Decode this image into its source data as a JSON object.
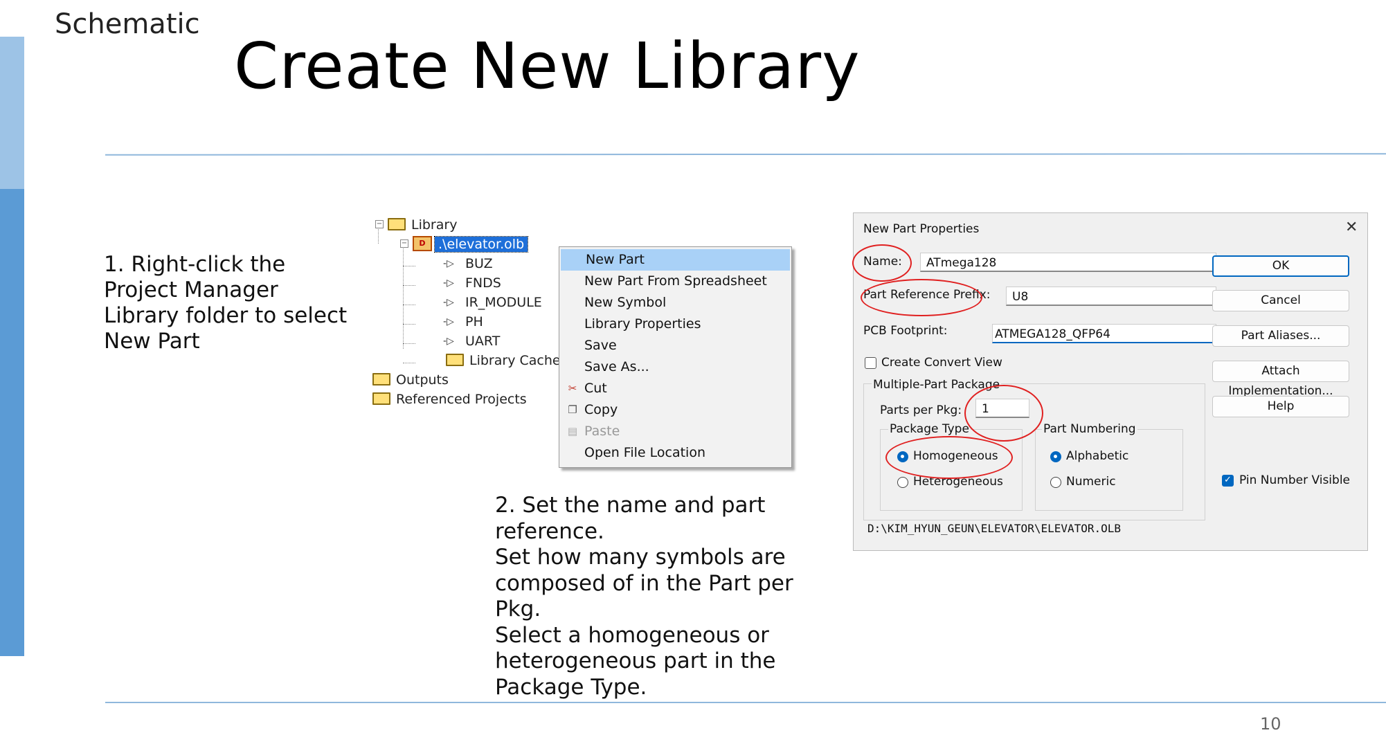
{
  "slide": {
    "section": "Schematic",
    "title": "Create New Library",
    "page_number": "10",
    "step1": "1. Right-click the Project Manager Library folder to select New Part",
    "step2": "2. Set the name and part reference.\nSet how many symbols are composed of in the Part per Pkg.\nSelect a homogeneous or heterogeneous part in the Package Type."
  },
  "tree": {
    "library": "Library",
    "olb": ".\\elevator.olb",
    "parts": [
      "BUZ",
      "FNDS",
      "IR_MODULE",
      "PH",
      "UART"
    ],
    "cache": "Library Cache",
    "outputs": "Outputs",
    "referenced": "Referenced Projects"
  },
  "menu": {
    "items": [
      {
        "label": "New Part",
        "highlighted": true
      },
      {
        "label": "New Part From Spreadsheet"
      },
      {
        "label": "New Symbol"
      },
      {
        "label": "Library Properties"
      },
      {
        "label": "Save"
      },
      {
        "label": "Save As..."
      },
      {
        "label": "Cut",
        "icon": "scissors-icon"
      },
      {
        "label": "Copy",
        "icon": "copy-icon"
      },
      {
        "label": "Paste",
        "icon": "paste-icon",
        "disabled": true
      },
      {
        "label": "Open File Location"
      }
    ]
  },
  "dialog": {
    "title": "New Part Properties",
    "close": "✕",
    "name_label": "Name:",
    "name_value": "ATmega128",
    "prefix_label": "Part Reference Prefix:",
    "prefix_value": "U8",
    "footprint_label": "PCB Footprint:",
    "footprint_value": "ATMEGA128_QFP64",
    "create_convert_label": "Create Convert View",
    "create_convert_checked": false,
    "multi_label": "Multiple-Part Package",
    "parts_per_pkg_label": "Parts per Pkg:",
    "parts_per_pkg_value": "1",
    "package_type_label": "Package Type",
    "homogeneous": "Homogeneous",
    "heterogeneous": "Heterogeneous",
    "package_type_selected": "Homogeneous",
    "part_numbering_label": "Part Numbering",
    "alphabetic": "Alphabetic",
    "numeric": "Numeric",
    "part_numbering_selected": "Alphabetic",
    "buttons": {
      "ok": "OK",
      "cancel": "Cancel",
      "aliases": "Part Aliases...",
      "attach": "Attach Implementation...",
      "help": "Help"
    },
    "pin_visible_label": "Pin Number Visible",
    "pin_visible_checked": true,
    "path": "D:\\KIM_HYUN_GEUN\\ELEVATOR\\ELEVATOR.OLB"
  },
  "colors": {
    "annotation": "#e02020",
    "accent_light": "#9dc3e6",
    "accent": "#5b9bd5",
    "selection": "#1e6fd9"
  }
}
